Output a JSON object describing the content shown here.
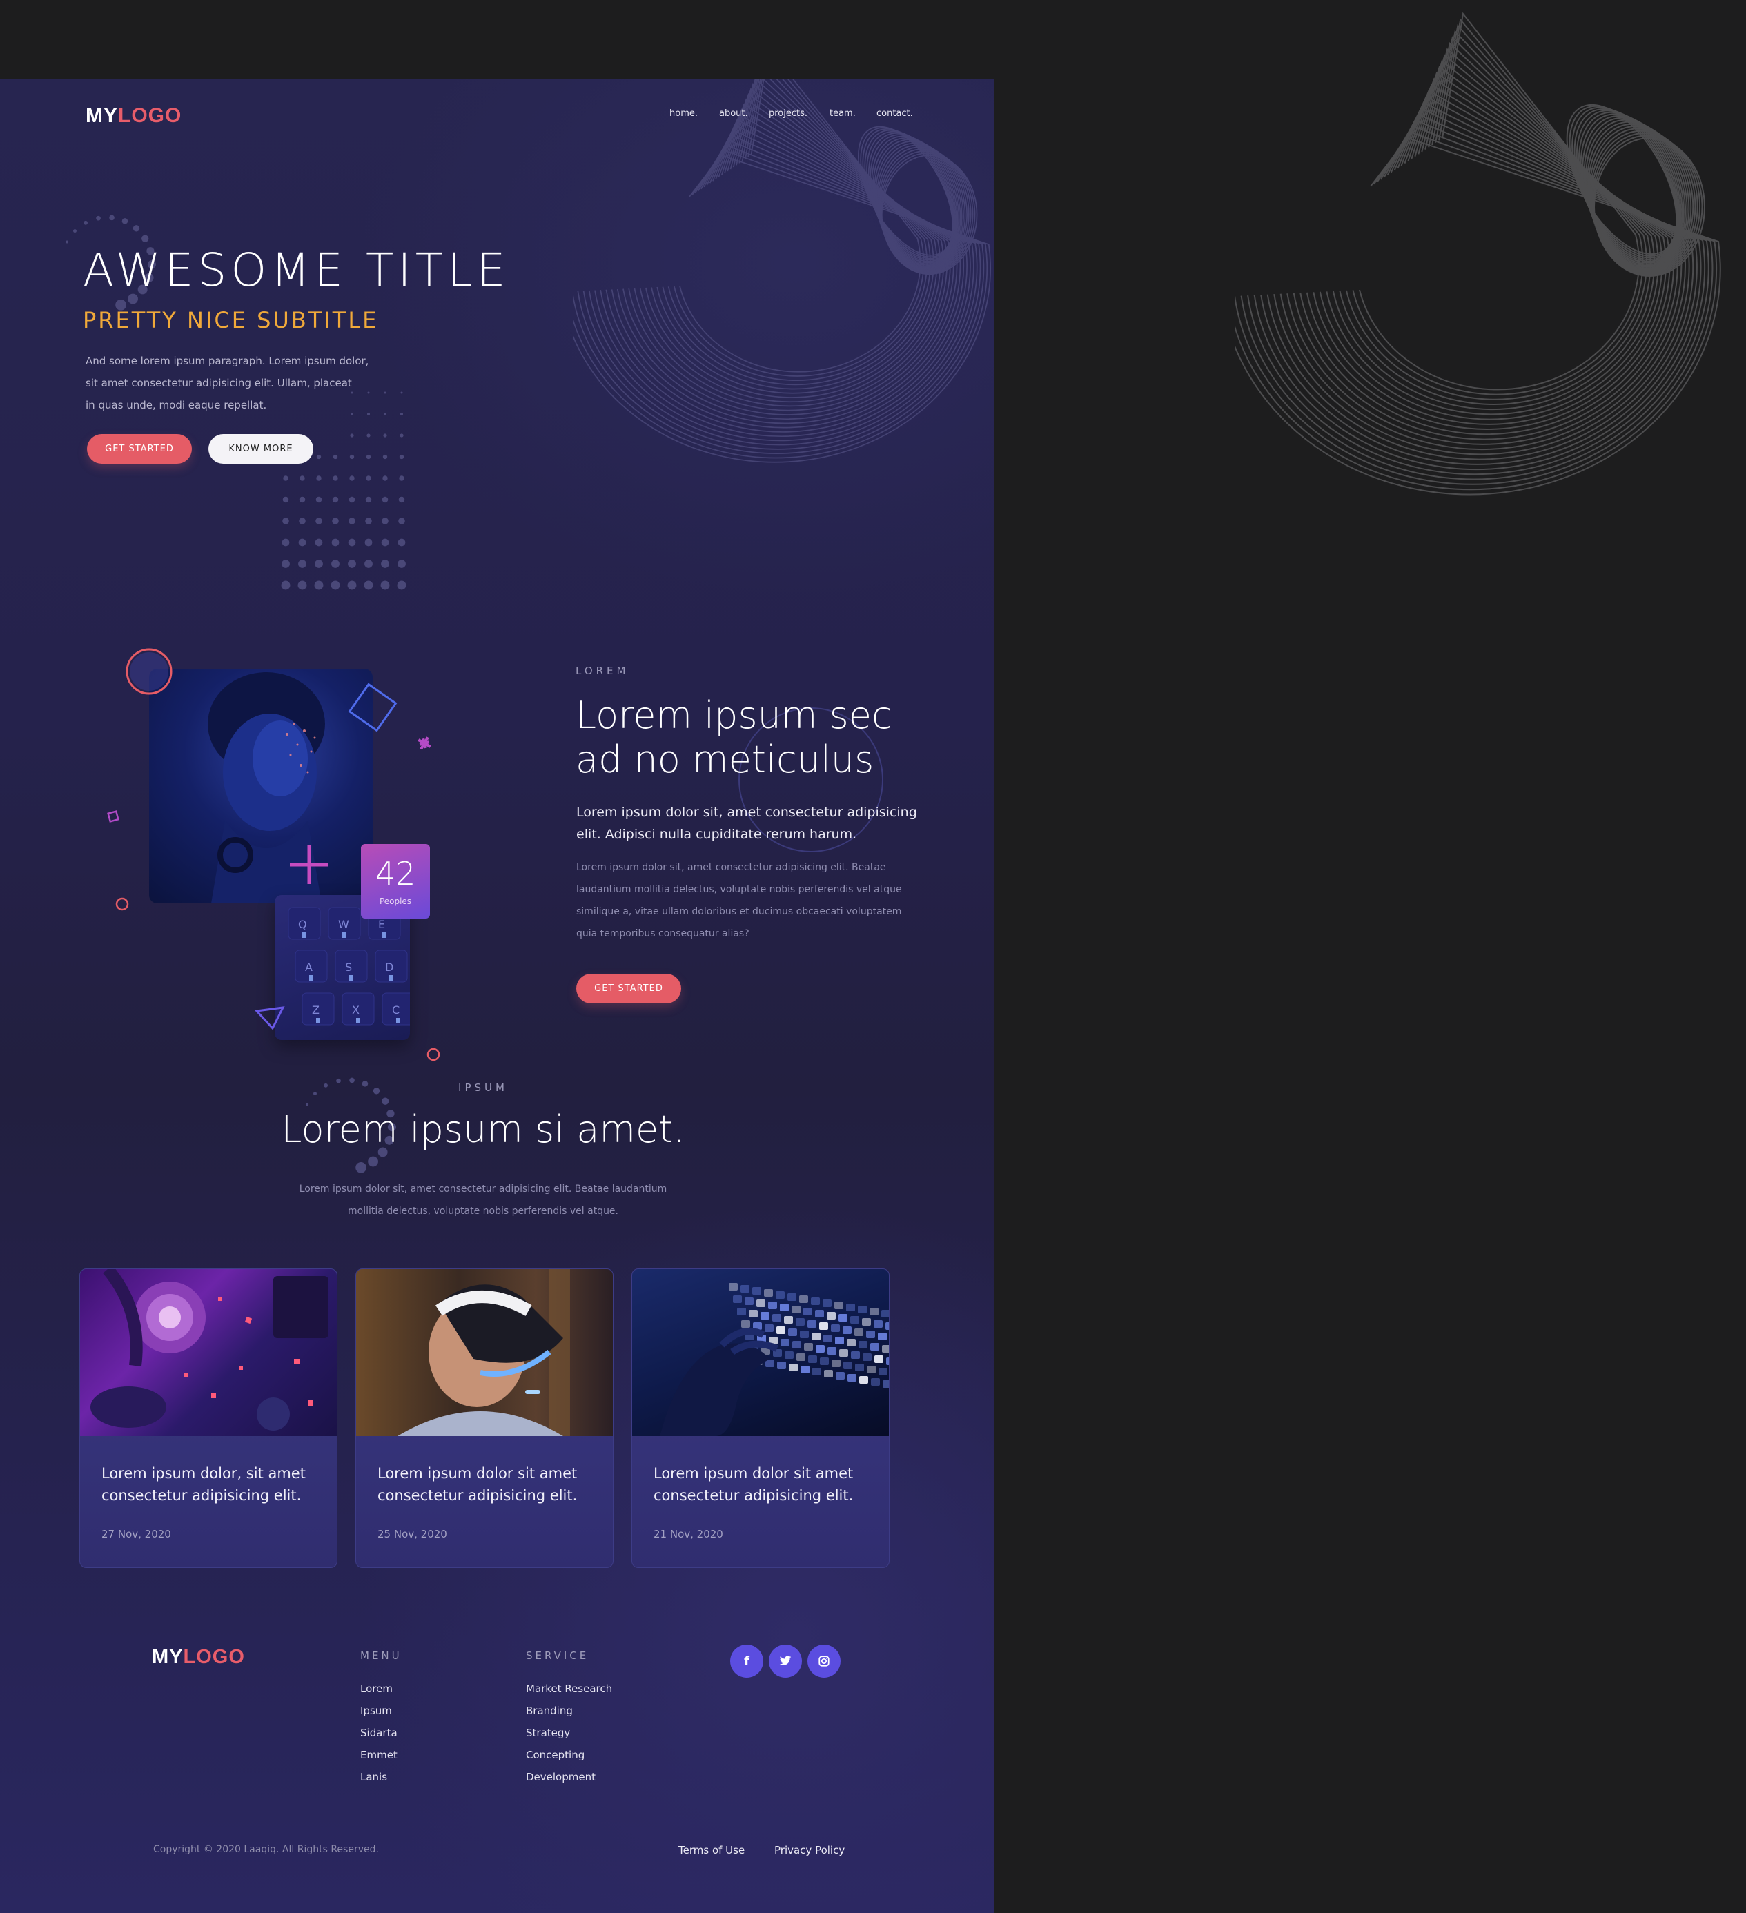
{
  "brand": {
    "logo_my": "MY",
    "logo_rest": "LOGO"
  },
  "colors": {
    "accent_red": "#e55c66",
    "accent_orange": "#f0a93a",
    "bg_dark": "#1d1d1e",
    "page_bg": "#25224c",
    "social": "#5b4de0"
  },
  "nav": {
    "items": [
      "home.",
      "about.",
      "projects.",
      "team.",
      "contact."
    ]
  },
  "hero": {
    "title": "AWESOME TITLE",
    "subtitle": "PRETTY NICE SUBTITLE",
    "paragraph_lines": [
      "And some lorem ipsum paragraph. Lorem ipsum dolor,",
      "sit amet consectetur adipisicing elit. Ullam, placeat",
      "in quas unde, modi eaque repellat."
    ],
    "btn_primary": "GET STARTED",
    "btn_secondary": "KNOW MORE"
  },
  "about": {
    "eyebrow": "LOREM",
    "heading_lines": [
      "Lorem ipsum sec",
      "ad no meticulus"
    ],
    "lead_lines": [
      "Lorem ipsum dolor sit, amet consectetur adipisicing",
      "elit. Adipisci nulla cupiditate rerum harum."
    ],
    "body_lines": [
      "Lorem ipsum dolor sit, amet consectetur adipisicing elit. Beatae",
      "laudantium mollitia delectus, voluptate nobis perferendis vel atque",
      "similique a, vitae ullam doloribus et ducimus obcaecati voluptatem",
      "quia temporibus consequatur alias?"
    ],
    "button": "GET STARTED",
    "stat_number": "42",
    "stat_label": "Peoples"
  },
  "posts": {
    "eyebrow": "IPSUM",
    "heading": "Lorem ipsum si amet.",
    "intro_lines": [
      "Lorem ipsum dolor sit, amet consectetur adipisicing elit. Beatae laudantium",
      "mollitia delectus, voluptate nobis perferendis vel atque."
    ],
    "cards": [
      {
        "title_lines": [
          "Lorem ipsum dolor, sit amet",
          "consectetur adipisicing elit."
        ],
        "date": "27 Nov, 2020",
        "image": "gaming-headset-photo"
      },
      {
        "title_lines": [
          "Lorem ipsum dolor sit amet",
          "consectetur adipisicing elit."
        ],
        "date": "25 Nov, 2020",
        "image": "vr-headset-photo"
      },
      {
        "title_lines": [
          "Lorem ipsum dolor sit amet",
          "consectetur adipisicing elit."
        ],
        "date": "21 Nov, 2020",
        "image": "keyboard-photo"
      }
    ]
  },
  "footer": {
    "menu_title": "MENU",
    "menu_items": [
      "Lorem",
      "Ipsum",
      "Sidarta",
      "Emmet",
      "Lanis"
    ],
    "service_title": "SERVICE",
    "service_items": [
      "Market Research",
      "Branding",
      "Strategy",
      "Concepting",
      "Development"
    ],
    "social_icons": [
      "facebook-icon",
      "twitter-icon",
      "instagram-icon"
    ],
    "copyright": "Copyright © 2020 Laaqiq. All Rights Reserved.",
    "terms": "Terms of Use",
    "privacy": "Privacy Policy"
  }
}
